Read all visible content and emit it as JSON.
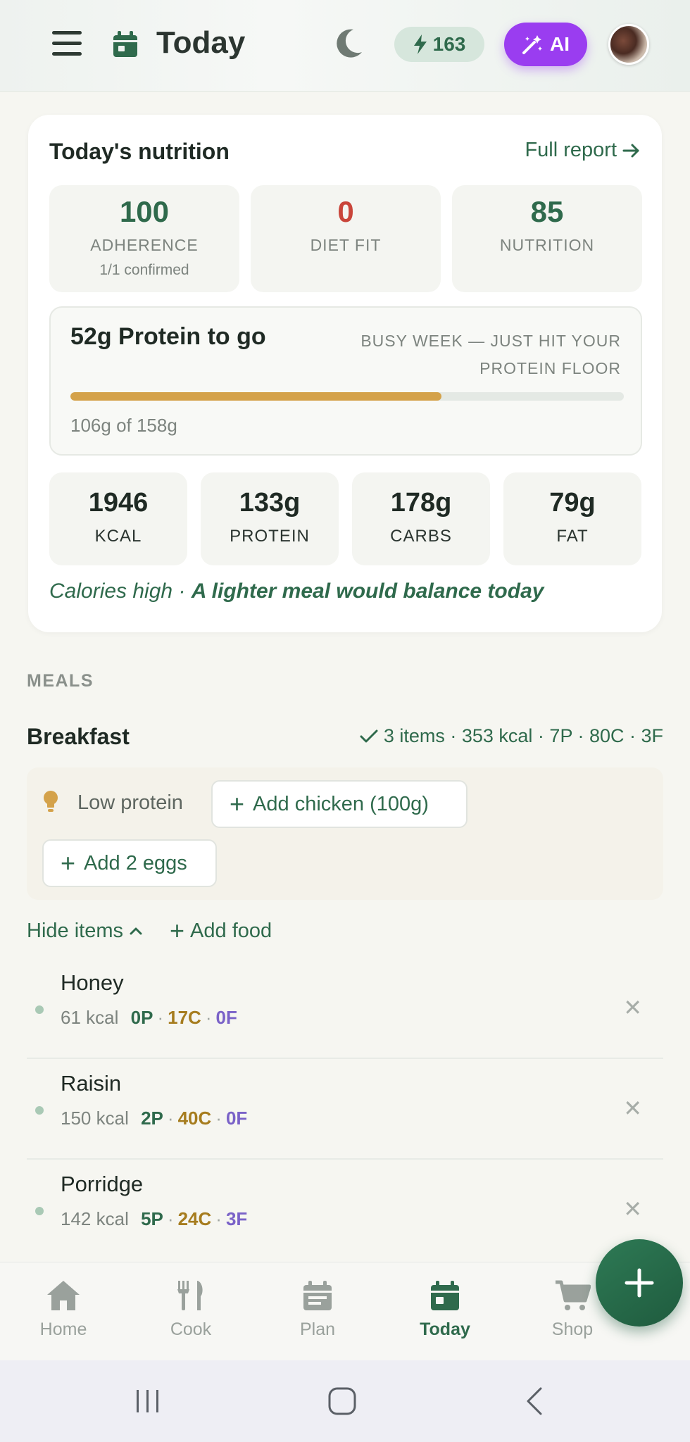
{
  "header": {
    "title": "Today",
    "streak_count": "163",
    "ai_label": "AI",
    "icons": [
      "menu-icon",
      "calendar-icon",
      "moon-icon",
      "lightning-icon",
      "magic-wand-icon"
    ]
  },
  "nutrition": {
    "title": "Today's nutrition",
    "full_report": "Full report",
    "scores": [
      {
        "value": "100",
        "label": "ADHERENCE",
        "sub": "1/1 confirmed",
        "color": "#2f6a4c"
      },
      {
        "value": "0",
        "label": "DIET FIT",
        "sub": "",
        "color": "#c9453a"
      },
      {
        "value": "85",
        "label": "NUTRITION",
        "sub": "",
        "color": "#2f6a4c"
      }
    ],
    "protein": {
      "title": "52g Protein to go",
      "note": "BUSY WEEK — JUST HIT YOUR PROTEIN FLOOR",
      "progress_fraction": 0.67,
      "sub": "106g of 158g",
      "bar_color": "#d4a24a"
    },
    "macros": [
      {
        "value": "1946",
        "label": "KCAL"
      },
      {
        "value": "133g",
        "label": "PROTEIN"
      },
      {
        "value": "178g",
        "label": "CARBS"
      },
      {
        "value": "79g",
        "label": "FAT"
      }
    ],
    "calorie_status": "Calories high",
    "calorie_dot": "·",
    "calorie_advice": "A lighter meal would balance today"
  },
  "meals": {
    "section_label": "MEALS",
    "breakfast": {
      "name": "Breakfast",
      "summary": "3 items · 353 kcal · 7P · 80C · 3F",
      "suggestion_label": "Low protein",
      "suggestions": [
        "Add chicken (100g)",
        "Add 2 eggs"
      ],
      "hide_items": "Hide items",
      "add_food": "Add food",
      "items": [
        {
          "name": "Honey",
          "kcal": "61 kcal",
          "p": "0P",
          "c": "17C",
          "f": "0F"
        },
        {
          "name": "Raisin",
          "kcal": "150 kcal",
          "p": "2P",
          "c": "40C",
          "f": "0F"
        },
        {
          "name": "Porridge",
          "kcal": "142 kcal",
          "p": "5P",
          "c": "24C",
          "f": "3F"
        }
      ]
    }
  },
  "nav": {
    "items": [
      {
        "label": "Home",
        "icon": "home-icon"
      },
      {
        "label": "Cook",
        "icon": "utensils-icon"
      },
      {
        "label": "Plan",
        "icon": "calendar-icon"
      },
      {
        "label": "Today",
        "icon": "calendar-today-icon"
      },
      {
        "label": "Shop",
        "icon": "cart-icon"
      }
    ],
    "active": "Today"
  },
  "colors": {
    "brand_green": "#2f6a4c",
    "ai_purple": "#9a3df0",
    "protein_gold": "#d4a24a",
    "diet_fit_red": "#c9453a"
  }
}
